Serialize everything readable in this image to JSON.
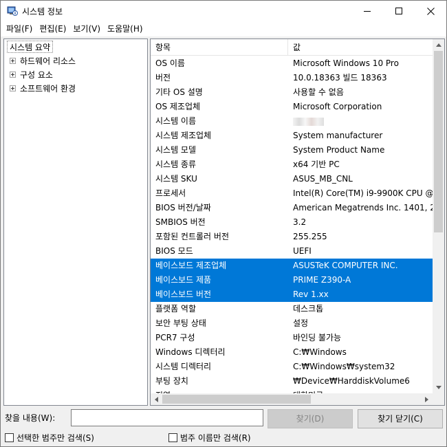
{
  "window": {
    "title": "시스템 정보",
    "icon": "system-info-icon"
  },
  "menu": [
    {
      "label": "파일(F)"
    },
    {
      "label": "편집(E)"
    },
    {
      "label": "보기(V)"
    },
    {
      "label": "도움말(H)"
    }
  ],
  "tree": {
    "root": "시스템 요약",
    "children": [
      {
        "label": "하드웨어 리소스"
      },
      {
        "label": "구성 요소"
      },
      {
        "label": "소프트웨어 환경"
      }
    ]
  },
  "list": {
    "columns": [
      "항목",
      "값"
    ],
    "rows": [
      {
        "item": "OS 이름",
        "value": "Microsoft Windows 10 Pro"
      },
      {
        "item": "버전",
        "value": "10.0.18363 빌드 18363"
      },
      {
        "item": "기타 OS 설명",
        "value": "사용할 수 없음"
      },
      {
        "item": "OS 제조업체",
        "value": "Microsoft Corporation"
      },
      {
        "item": "시스템 이름",
        "value": ""
      },
      {
        "item": "시스템 제조업체",
        "value": "System manufacturer"
      },
      {
        "item": "시스템 모델",
        "value": "System Product Name"
      },
      {
        "item": "시스템 종류",
        "value": "x64 기반 PC"
      },
      {
        "item": "시스템 SKU",
        "value": "ASUS_MB_CNL"
      },
      {
        "item": "프로세서",
        "value": "Intel(R) Core(TM) i9-9900K CPU @"
      },
      {
        "item": "BIOS 버전/날짜",
        "value": "American Megatrends Inc. 1401, 2"
      },
      {
        "item": "SMBIOS 버전",
        "value": "3.2"
      },
      {
        "item": "포함된 컨트롤러 버전",
        "value": "255.255"
      },
      {
        "item": "BIOS 모드",
        "value": "UEFI"
      },
      {
        "item": "베이스보드 제조업체",
        "value": "ASUSTeK COMPUTER INC.",
        "selected": true
      },
      {
        "item": "베이스보드 제품",
        "value": "PRIME Z390-A",
        "selected": true
      },
      {
        "item": "베이스보드 버전",
        "value": "Rev 1.xx",
        "selected": true
      },
      {
        "item": "플랫폼 역할",
        "value": "데스크톱"
      },
      {
        "item": "보안 부팅 상태",
        "value": "설정"
      },
      {
        "item": "PCR7 구성",
        "value": "바인딩 불가능"
      },
      {
        "item": "Windows 디렉터리",
        "value": "C:₩Windows"
      },
      {
        "item": "시스템 디렉터리",
        "value": "C:₩Windows₩system32"
      },
      {
        "item": "부팅 장치",
        "value": "₩Device₩HarddiskVolume6"
      },
      {
        "item": "지역",
        "value": "대한민국"
      }
    ],
    "selection_color": "#0078d7"
  },
  "find": {
    "label": "찾을 내용(W):",
    "input_value": "",
    "find_button": "찾기(D)",
    "close_button": "찾기 닫기(C)",
    "checkbox_selected_category": "선택한 범주만 검색(S)",
    "checkbox_category_names": "범주 이름만 검색(R)"
  }
}
